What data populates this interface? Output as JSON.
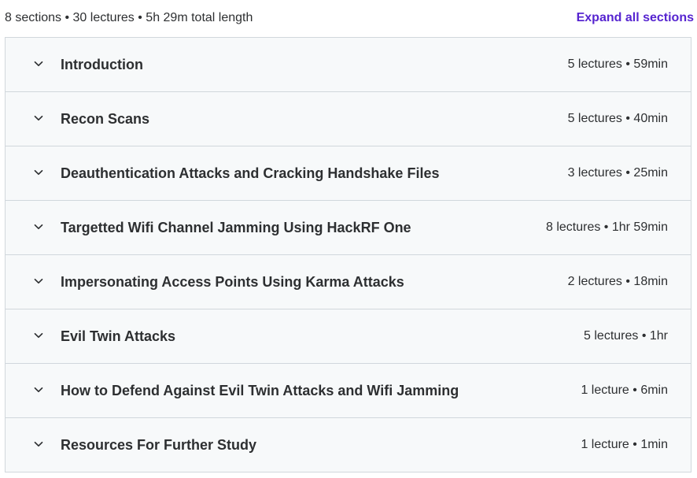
{
  "curriculum": {
    "summary": "8 sections • 30 lectures • 5h 29m total length",
    "expand_label": "Expand all sections",
    "sections": [
      {
        "title": "Introduction",
        "meta": "5 lectures • 59min"
      },
      {
        "title": "Recon Scans",
        "meta": "5 lectures • 40min"
      },
      {
        "title": "Deauthentication Attacks and Cracking Handshake Files",
        "meta": "3 lectures • 25min"
      },
      {
        "title": "Targetted Wifi Channel Jamming Using HackRF One",
        "meta": "8 lectures • 1hr 59min"
      },
      {
        "title": "Impersonating Access Points Using Karma Attacks",
        "meta": "2 lectures • 18min"
      },
      {
        "title": "Evil Twin Attacks",
        "meta": "5 lectures • 1hr"
      },
      {
        "title": "How to Defend Against Evil Twin Attacks and Wifi Jamming",
        "meta": "1 lecture • 6min"
      },
      {
        "title": "Resources For Further Study",
        "meta": "1 lecture • 1min"
      }
    ]
  },
  "icons": {
    "section_toggle": "chevron-down-icon"
  },
  "colors": {
    "accent": "#5624d0",
    "row_background": "#f7f9fa",
    "border": "#d1d7dc",
    "text": "#2d2f31"
  }
}
